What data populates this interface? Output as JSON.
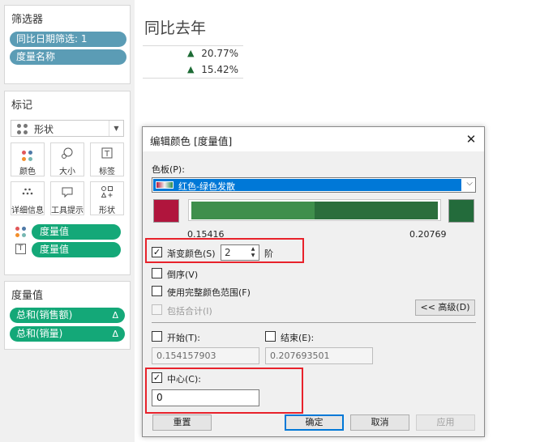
{
  "filters": {
    "title": "筛选器",
    "items": [
      "同比日期筛选: 1",
      "度量名称"
    ]
  },
  "marks": {
    "title": "标记",
    "mark_type": "形状",
    "buttons": {
      "color": "颜色",
      "size": "大小",
      "label": "标签",
      "detail": "详细信息",
      "tooltip": "工具提示",
      "shape": "形状"
    },
    "fields": [
      "度量值",
      "度量值"
    ]
  },
  "measures": {
    "title": "度量值",
    "items": [
      {
        "label": "总和(销售额)",
        "delta": "Δ"
      },
      {
        "label": "总和(销量)",
        "delta": "Δ"
      }
    ]
  },
  "view": {
    "title": "同比去年",
    "rows": [
      {
        "arrow": "▲",
        "value": "20.77%"
      },
      {
        "arrow": "▲",
        "value": "15.42%"
      }
    ]
  },
  "dialog": {
    "title": "编辑颜色 [度量值]",
    "palette_label": "色板(P):",
    "palette_value": "红色-绿色发散",
    "range_min": "0.15416",
    "range_max": "0.20769",
    "stepped_label": "渐变颜色(S)",
    "steps_value": "2",
    "steps_unit": "阶",
    "reversed_label": "倒序(V)",
    "full_range_label": "使用完整颜色范围(F)",
    "include_totals_label": "包括合计(I)",
    "advanced_button": "<< 高级(D)",
    "start_label": "开始(T):",
    "end_label": "结束(E):",
    "start_value": "0.154157903",
    "end_value": "0.207693501",
    "center_label": "中心(C):",
    "center_value": "0",
    "reset_button": "重置",
    "ok_button": "确定",
    "cancel_button": "取消",
    "apply_button": "应用"
  },
  "colors": {
    "pill_blue": "#5b9cb5",
    "pill_green": "#14a878",
    "swatch_red": "#b0153d",
    "swatch_green": "#236b3b",
    "ramp_light_green": "#3f8f4c",
    "ramp_dark_green": "#2b6e3c",
    "highlight_red": "#e8222b",
    "up_arrow": "#1d6b35"
  }
}
